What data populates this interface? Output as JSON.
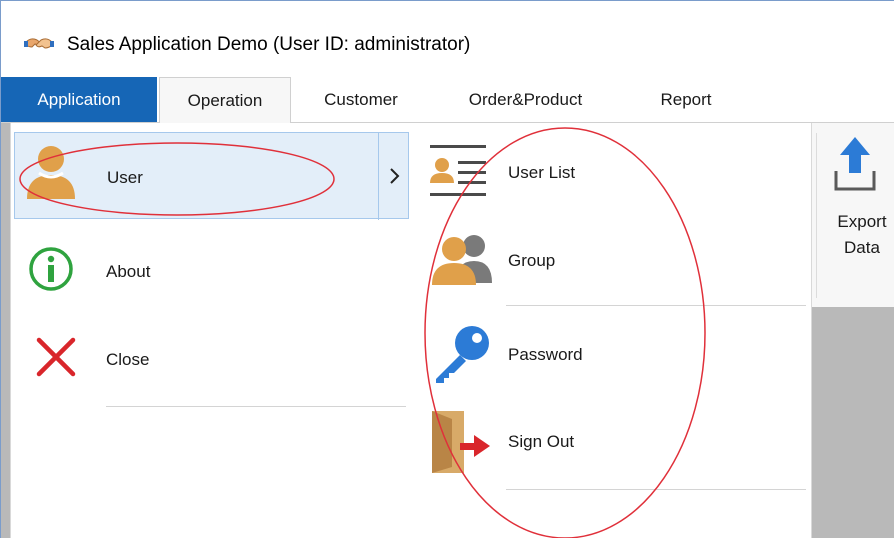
{
  "window": {
    "title": "Sales Application Demo (User ID: administrator)",
    "app_icon": "handshake-icon"
  },
  "tabs": [
    {
      "label": "Application",
      "state": "application-menu"
    },
    {
      "label": "Operation",
      "state": "selected"
    },
    {
      "label": "Customer",
      "state": "normal"
    },
    {
      "label": "Order&Product",
      "state": "normal"
    },
    {
      "label": "Report",
      "state": "normal"
    }
  ],
  "app_menu": {
    "items": [
      {
        "label": "User",
        "icon": "user-icon",
        "highlighted": true,
        "has_submenu": true
      },
      {
        "label": "About",
        "icon": "info-icon"
      },
      {
        "label": "Close",
        "icon": "close-icon"
      }
    ],
    "submenu": [
      {
        "label": "User List",
        "icon": "user-list-icon"
      },
      {
        "label": "Group",
        "icon": "group-icon"
      },
      {
        "label": "Password",
        "icon": "key-icon"
      },
      {
        "label": "Sign Out",
        "icon": "sign-out-icon"
      }
    ]
  },
  "ribbon": {
    "export_button": {
      "line1": "Export",
      "line2": "Data",
      "icon": "upload-arrow-icon"
    }
  },
  "colors": {
    "app_tab": "#1666b6",
    "hover_bg": "#e3eef9",
    "hover_border": "#a6c8ec",
    "annotation": "#e0303a",
    "user_icon": "#e0a04a",
    "info_icon": "#2fa33f",
    "close_icon": "#d9262b",
    "key_icon": "#2c7bd6",
    "export_arrow": "#2c7bd6"
  }
}
